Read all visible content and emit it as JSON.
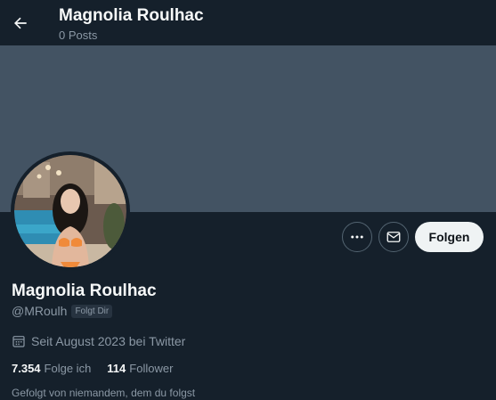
{
  "header": {
    "name": "Magnolia Roulhac",
    "posts": "0 Posts"
  },
  "banner": {
    "color": "#435363"
  },
  "profile": {
    "display_name": "Magnolia Roulhac",
    "handle": "@MRoulh",
    "follows_you_badge": "Folgt Dir",
    "joined": "Seit August 2023 bei Twitter",
    "following_count": "7.354",
    "following_label": "Folge ich",
    "followers_count": "114",
    "followers_label": "Follower",
    "followed_by": "Gefolgt von niemandem, dem du folgst"
  },
  "actions": {
    "more_icon": "more-icon",
    "message_icon": "mail-icon",
    "follow_label": "Folgen"
  },
  "colors": {
    "background": "#15202b",
    "text_primary": "#f7f9f9",
    "text_secondary": "#8b98a5",
    "follow_button_bg": "#eff3f4"
  }
}
